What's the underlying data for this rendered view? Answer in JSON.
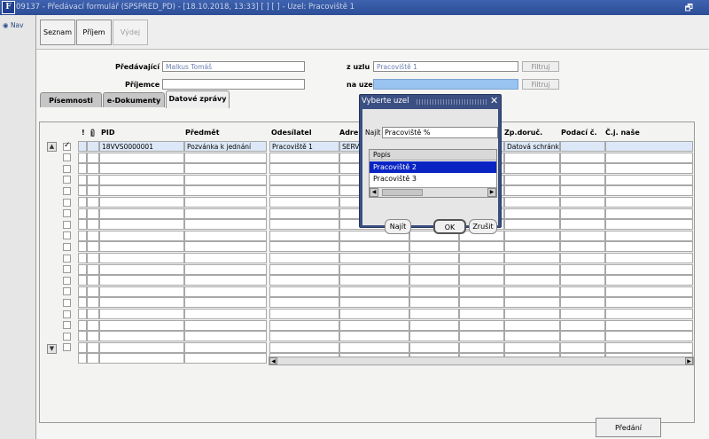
{
  "window": {
    "title": "09137 - Předávací formulář (SPSPRED_PD) - [18.10.2018, 13:33] [ ] [ ] - Uzel: Pracoviště 1",
    "app_icon": "F",
    "restore_glyph": "🗗",
    "close_glyph": "✕"
  },
  "nav": {
    "label": "Nav",
    "icon": "globe-icon"
  },
  "toolbar": {
    "seznam": "Seznam",
    "prijem": "Příjem",
    "vydej": "Výdej"
  },
  "form": {
    "predavajici_label": "Předávající",
    "predavajici_value": "Malkus Tomáš",
    "prijemce_label": "Příjemce",
    "prijemce_value": "",
    "z_uzlu_label": "z uzlu",
    "z_uzlu_value": "Pracoviště 1",
    "na_uzel_label": "na uzel",
    "na_uzel_value": "",
    "filtruj": "Filtruj"
  },
  "tabs": [
    "Písemnosti",
    "e-Dokumenty",
    "Datové zprávy"
  ],
  "active_tab": 2,
  "grid": {
    "headers": {
      "excl": "!",
      "pid": "PID",
      "predmet": "Předmět",
      "odesilatel": "Odesílatel",
      "adresa": "Adre",
      "zpdoruc": "Zp.doruč.",
      "podaci": "Podací č.",
      "cj": "Č.j. naše"
    },
    "first_row": {
      "pid": "18VVS0000001",
      "predmet": "Pozvánka k jednání",
      "odesilatel": "Pracoviště 1",
      "adresa": "SERV",
      "zpdoruc": "Datová schránk"
    },
    "row_count": 20
  },
  "dialog": {
    "title": "Vyberte uzel",
    "find_label": "Najít",
    "find_value": "Pracoviště %",
    "column": "Popis",
    "items": [
      "Pracoviště 2",
      "Pracoviště 3"
    ],
    "selected_index": 0,
    "btn_najit": "Najít",
    "btn_ok": "OK",
    "btn_zrusit": "Zrušit"
  },
  "predani": "Předání",
  "colors": {
    "titlebar": "#2c4d96",
    "selection": "#0a24c4",
    "na_uzel_field": "#99c3f0"
  }
}
